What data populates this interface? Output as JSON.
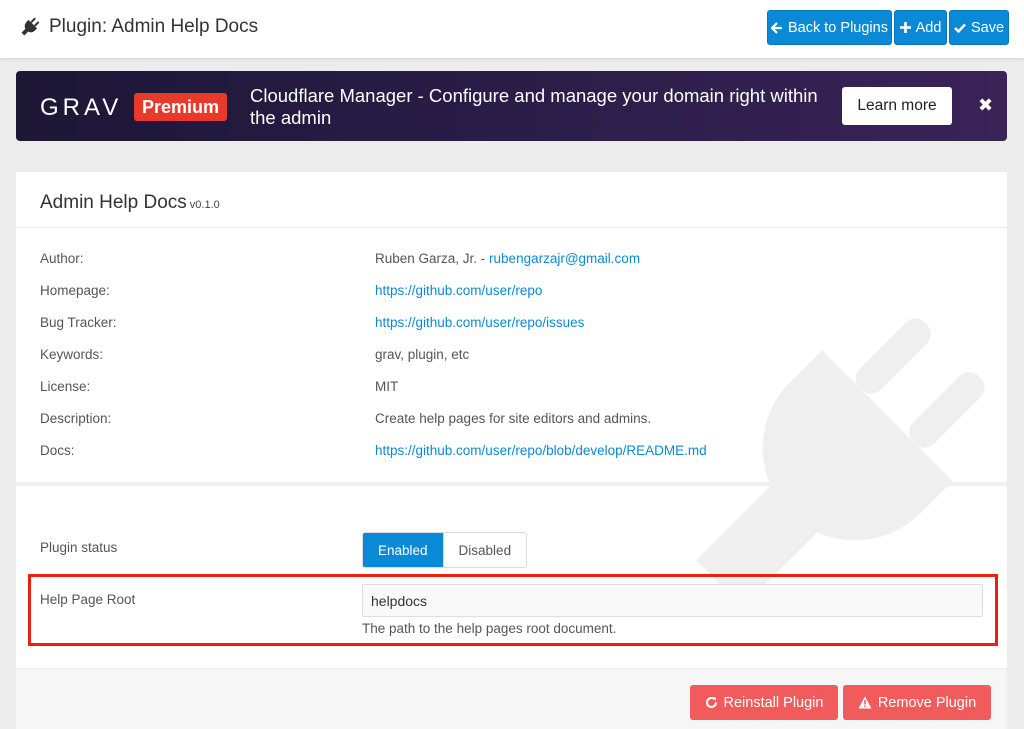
{
  "header": {
    "title": "Plugin: Admin Help Docs",
    "back_label": "Back to Plugins",
    "add_label": "Add",
    "save_label": "Save"
  },
  "banner": {
    "logo_text": "GRAV",
    "premium_label": "Premium",
    "message": "Cloudflare Manager - Configure and manage your domain right within the admin",
    "cta_label": "Learn more",
    "close_label": "✖"
  },
  "plugin": {
    "name": "Admin Help Docs",
    "version": "v0.1.0",
    "info": [
      {
        "label": "Author:",
        "value": "Ruben Garza, Jr. - ",
        "link": "rubengarzajr@gmail.com"
      },
      {
        "label": "Homepage:",
        "value": "",
        "link": "https://github.com/user/repo"
      },
      {
        "label": "Bug Tracker:",
        "value": "",
        "link": "https://github.com/user/repo/issues"
      },
      {
        "label": "Keywords:",
        "value": "grav, plugin, etc",
        "link": ""
      },
      {
        "label": "License:",
        "value": "MIT",
        "link": ""
      },
      {
        "label": "Description:",
        "value": "Create help pages for site editors and admins.",
        "link": ""
      },
      {
        "label": "Docs:",
        "value": "",
        "link": "https://github.com/user/repo/blob/develop/README.md"
      }
    ]
  },
  "form": {
    "status_label": "Plugin status",
    "enabled_label": "Enabled",
    "disabled_label": "Disabled",
    "root_label": "Help Page Root",
    "root_value": "helpdocs",
    "root_help": "The path to the help pages root document."
  },
  "footer": {
    "reinstall_label": "Reinstall Plugin",
    "remove_label": "Remove Plugin"
  },
  "colors": {
    "accent": "#0a8ad6",
    "danger": "#f25b5b",
    "highlight": "#e8220e"
  }
}
